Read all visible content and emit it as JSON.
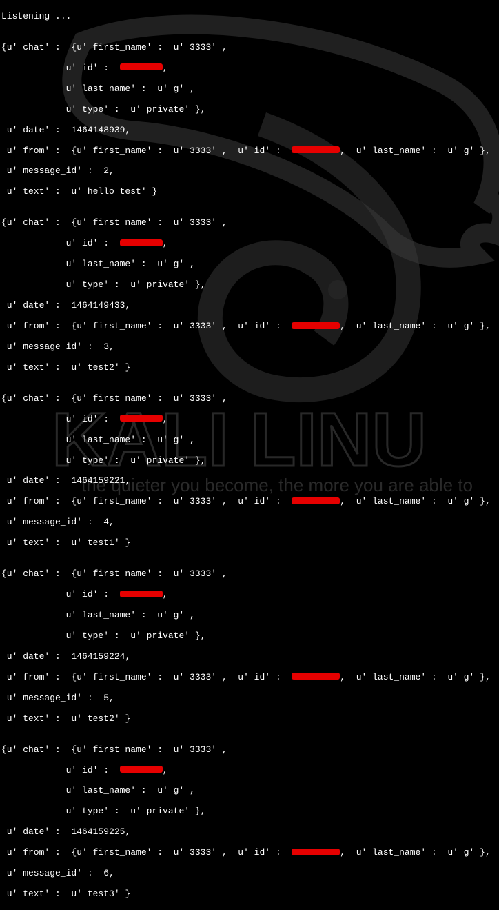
{
  "listening": "Listening ...",
  "messages": [
    {
      "chat_first_name": "3333",
      "chat_last_name": "g",
      "chat_type": "private",
      "date": "1464148939",
      "from_first_name": "3333",
      "from_last_name": "g",
      "message_id": "2",
      "text": "hello test"
    },
    {
      "chat_first_name": "3333",
      "chat_last_name": "g",
      "chat_type": "private",
      "date": "1464149433",
      "from_first_name": "3333",
      "from_last_name": "g",
      "message_id": "3",
      "text": "test2"
    },
    {
      "chat_first_name": "3333",
      "chat_last_name": "g",
      "chat_type": "private",
      "date": "1464159221",
      "from_first_name": "3333",
      "from_last_name": "g",
      "message_id": "4",
      "text": "test1"
    },
    {
      "chat_first_name": "3333",
      "chat_last_name": "g",
      "chat_type": "private",
      "date": "1464159224",
      "from_first_name": "3333",
      "from_last_name": "g",
      "message_id": "5",
      "text": "test2"
    },
    {
      "chat_first_name": "3333",
      "chat_last_name": "g",
      "chat_type": "private",
      "date": "1464159225",
      "from_first_name": "3333",
      "from_last_name": "g",
      "message_id": "6",
      "text": "test3"
    }
  ],
  "bg": {
    "brand_text": "KALI LINU",
    "tagline": "the quieter you become, the more you are able to"
  }
}
